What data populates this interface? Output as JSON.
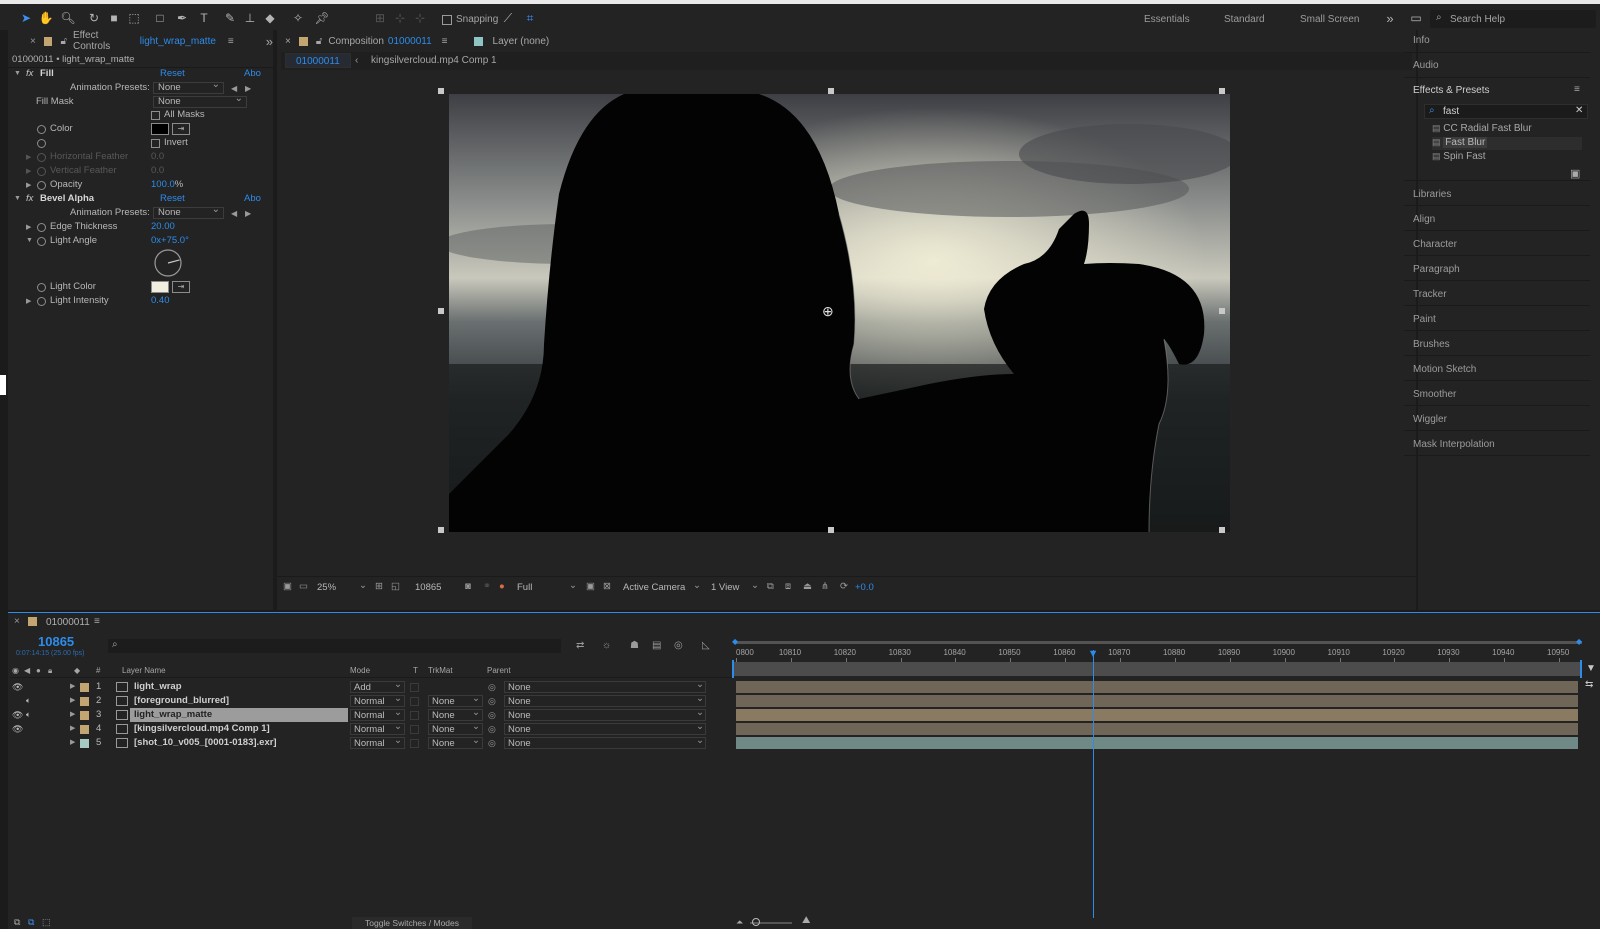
{
  "toolbar": {
    "snapping": "Snapping",
    "workspaces": [
      "Essentials",
      "Standard",
      "Small Screen"
    ],
    "search_placeholder": "Search Help",
    "icons": [
      "selection-tool",
      "hand-tool",
      "zoom-tool",
      "rotate-tool",
      "camera-tool",
      "pan-behind-tool",
      "rectangle-tool",
      "pen-tool",
      "type-tool",
      "brush-tool",
      "clone-stamp-tool",
      "eraser-tool",
      "roto-brush-tool",
      "puppet-pin-tool"
    ]
  },
  "effect_controls": {
    "tab_prefix": "Effect Controls",
    "layer": "light_wrap_matte",
    "breadcrumb": "01000011 • light_wrap_matte",
    "fill": {
      "name": "Fill",
      "reset": "Reset",
      "about": "Abo",
      "animation_presets_label": "Animation Presets:",
      "animation_presets_value": "None",
      "fill_mask_label": "Fill Mask",
      "fill_mask_value": "None",
      "all_masks": "All Masks",
      "color_label": "Color",
      "invert": "Invert",
      "horizontal_feather": "Horizontal Feather",
      "horizontal_feather_value": "0.0",
      "vertical_feather": "Vertical Feather",
      "vertical_feather_value": "0.0",
      "opacity_label": "Opacity",
      "opacity_value": "100.0",
      "opacity_unit": "%",
      "color": "#000000"
    },
    "bevel": {
      "name": "Bevel Alpha",
      "reset": "Reset",
      "about": "Abo",
      "animation_presets_label": "Animation Presets:",
      "animation_presets_value": "None",
      "edge_thickness_label": "Edge Thickness",
      "edge_thickness_value": "20.00",
      "light_angle_label": "Light Angle",
      "light_angle_value": "0x+75.0°",
      "light_angle_deg": 75,
      "light_color_label": "Light Color",
      "light_color": "#f1efdf",
      "light_intensity_label": "Light Intensity",
      "light_intensity_value": "0.40"
    }
  },
  "composition": {
    "tab_prefix": "Composition",
    "name": "01000011",
    "layer_tab": "Layer (none)",
    "breadcrumb_active": "01000011",
    "breadcrumb_item": "kingsilvercloud.mp4 Comp 1",
    "footer": {
      "zoom": "25%",
      "frame": "10865",
      "resolution": "Full",
      "camera": "Active Camera",
      "view": "1 View",
      "exposure": "+0.0"
    }
  },
  "right_panel": {
    "top_items": [
      "Info",
      "Audio"
    ],
    "effects_title": "Effects & Presets",
    "search_value": "fast",
    "results": [
      "CC Radial Fast Blur",
      "Fast Blur",
      "Spin Fast"
    ],
    "selected_result": "Fast Blur",
    "items": [
      "Libraries",
      "Align",
      "Character",
      "Paragraph",
      "Tracker",
      "Paint",
      "Brushes",
      "Motion Sketch",
      "Smoother",
      "Wiggler",
      "Mask Interpolation"
    ]
  },
  "timeline": {
    "tab": "01000011",
    "current_time": "10865",
    "timecode_sub": "0:07:14:15 (25.00 fps)",
    "columns": {
      "num": "#",
      "layer_name": "Layer Name",
      "mode": "Mode",
      "t": "T",
      "trkmat": "TrkMat",
      "parent": "Parent"
    },
    "layers": [
      {
        "num": "1",
        "name": "light_wrap",
        "mode": "Add",
        "trkmat": "",
        "parent": "None",
        "color": "#c2a571",
        "bar_color": "#6f6658",
        "video": true,
        "audio": false
      },
      {
        "num": "2",
        "name": "[foreground_blurred]",
        "mode": "Normal",
        "trkmat": "None",
        "parent": "None",
        "color": "#c2a571",
        "bar_color": "#6f6658",
        "video": false,
        "audio": true
      },
      {
        "num": "3",
        "name": "light_wrap_matte",
        "mode": "Normal",
        "trkmat": "None",
        "parent": "None",
        "color": "#c2a571",
        "bar_color": "#8a7a62",
        "video": true,
        "audio": true
      },
      {
        "num": "4",
        "name": "[kingsilvercloud.mp4 Comp 1]",
        "mode": "Normal",
        "trkmat": "None",
        "parent": "None",
        "color": "#c2a571",
        "bar_color": "#6f6658",
        "video": true,
        "audio": false
      },
      {
        "num": "5",
        "name": "[shot_10_v005_[0001-0183].exr]",
        "mode": "Normal",
        "trkmat": "None",
        "parent": "None",
        "color": "#a6cbc4",
        "bar_color": "#6f8a86",
        "video": false,
        "audio": false
      }
    ],
    "ruler": [
      "0800",
      "10810",
      "10820",
      "10830",
      "10840",
      "10850",
      "10860",
      "10870",
      "10880",
      "10890",
      "10900",
      "10910",
      "10920",
      "10930",
      "10940",
      "10950"
    ],
    "playhead_frame": 10865,
    "ruler_start": 10800,
    "ruler_end": 10952,
    "toggle_label": "Toggle Switches / Modes"
  }
}
